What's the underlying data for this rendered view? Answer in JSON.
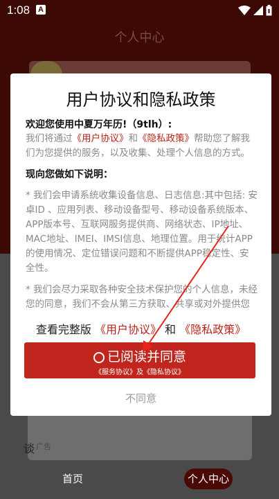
{
  "status_bar": {
    "time": "1:08",
    "badge": "A"
  },
  "header": {
    "title": "个人中心"
  },
  "background": {
    "ad_label": "广告",
    "left_glyph": "谈"
  },
  "bottom_nav": {
    "home": "首页",
    "me": "个人中心"
  },
  "dialog": {
    "title": "用户协议和隐私政策",
    "welcome": "欢迎您使用中夏万年历!（9tlh）:",
    "intro_before": "我们将通过",
    "intro_link1": "《用户协议》",
    "intro_and": "和",
    "intro_link2": "《隐私政策》",
    "intro_after": "帮助您了解我们为您提供的服务，以及收集、处理个人信息的方式。",
    "notice_head": "现向您做如下说明：",
    "item1": "* 我们会申请系统收集设备信息、日志信息:其中包括: 安卓ID 、应用列表、移动设备型号、移动设备系统版本、APP版本号、互联网服务提供商、网络状态、IP地址、MAC地址、IMEI、IMSI信息、地理位置。用于统计APP的使用情况、定位错误问题和不断提供APP稳定性、安全性。",
    "item2": "* 我们会尽力采取各种安全技术保护您的个人信息，未经您的同意，我们不会从第三方获取、共享或对外提供您",
    "full_prefix": "查看完整版",
    "full_link1": "《用户协议》",
    "full_and": "和",
    "full_link2": "《隐私政策》",
    "agree_label": "已阅读并同意",
    "agree_sub": "《服务协议》及《隐私协议》",
    "decline_label": "不同意"
  },
  "colors": {
    "accent": "#c0261d",
    "link": "#b8241b",
    "header_dark": "#3d0904"
  }
}
